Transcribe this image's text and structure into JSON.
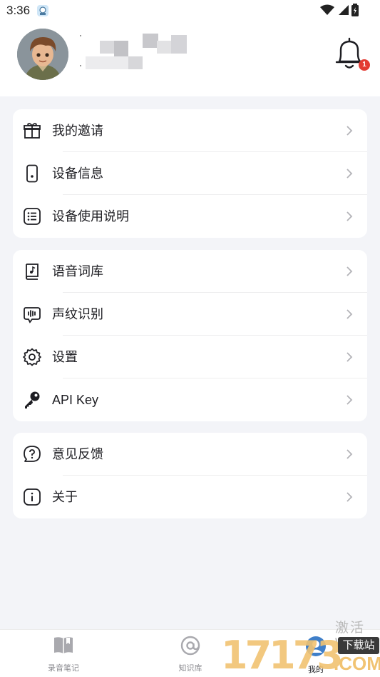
{
  "status_bar": {
    "time": "3:36"
  },
  "profile": {
    "notification_count": "1"
  },
  "groups": [
    {
      "items": [
        {
          "label": "我的邀请",
          "icon": "gift-icon"
        },
        {
          "label": "设备信息",
          "icon": "device-icon"
        },
        {
          "label": "设备使用说明",
          "icon": "list-icon"
        }
      ]
    },
    {
      "items": [
        {
          "label": "语音词库",
          "icon": "music-book-icon"
        },
        {
          "label": "声纹识别",
          "icon": "voiceprint-icon"
        },
        {
          "label": "设置",
          "icon": "gear-icon"
        },
        {
          "label": "API Key",
          "icon": "key-icon"
        }
      ]
    },
    {
      "items": [
        {
          "label": "意见反馈",
          "icon": "question-bubble-icon"
        },
        {
          "label": "关于",
          "icon": "info-icon"
        }
      ]
    }
  ],
  "tabbar": {
    "tabs": [
      {
        "label": "录音笔记",
        "icon": "notebook-icon"
      },
      {
        "label": "知识库",
        "icon": "at-icon"
      },
      {
        "label": "我的",
        "icon": "profile-icon"
      }
    ],
    "active_index": 2
  },
  "watermark": {
    "text": "激活 W",
    "digits": "17173",
    "badge": "下载站",
    "suffix": ".COM"
  },
  "colors": {
    "badge_red": "#e33b33",
    "page_bg": "#f3f4f8",
    "card_bg": "#ffffff"
  }
}
